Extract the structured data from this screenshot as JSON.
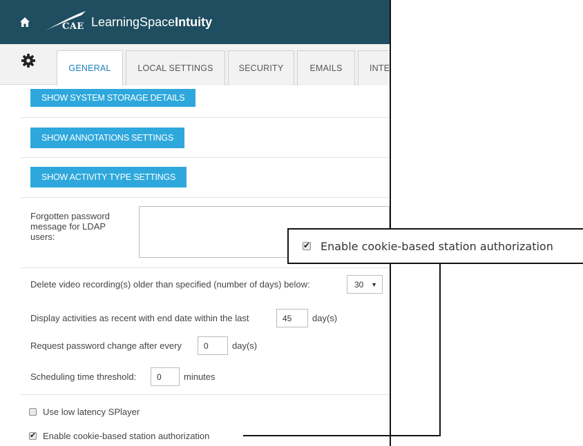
{
  "header": {
    "logo_word": "CAE",
    "app_title_light": "LearningSpace",
    "app_title_bold": "Intuity",
    "bg_color": "#1f4e60"
  },
  "tabs": [
    {
      "label": "GENERAL",
      "active": true
    },
    {
      "label": "LOCAL SETTINGS",
      "active": false
    },
    {
      "label": "SECURITY",
      "active": false
    },
    {
      "label": "EMAILS",
      "active": false
    },
    {
      "label": "INTE",
      "active": false
    }
  ],
  "buttons": {
    "storage": "SHOW SYSTEM STORAGE DETAILS",
    "annotations": "SHOW ANNOTATIONS SETTINGS",
    "activity": "SHOW ACTIVITY TYPE SETTINGS",
    "color": "#2ea8dc"
  },
  "ldap": {
    "label_line1": "Forgotten password",
    "label_line2": "message for LDAP",
    "label_line3": "users:",
    "value": ""
  },
  "settings": {
    "delete_label": "Delete video recording(s) older than specified (number of days) below:",
    "delete_value": "30",
    "recent_label": "Display activities as recent with end date within the last",
    "recent_value": "45",
    "recent_unit": "day(s)",
    "password_label": "Request password change after every",
    "password_value": "0",
    "password_unit": "day(s)",
    "schedule_label": "Scheduling time threshold:",
    "schedule_value": "0",
    "schedule_unit": "minutes"
  },
  "checkboxes": {
    "low_latency_label": "Use low latency SPlayer",
    "low_latency_checked": false,
    "cookie_label": "Enable cookie-based station authorization",
    "cookie_checked": true
  },
  "callout": {
    "text": "Enable cookie-based station authorization",
    "checked": true
  }
}
